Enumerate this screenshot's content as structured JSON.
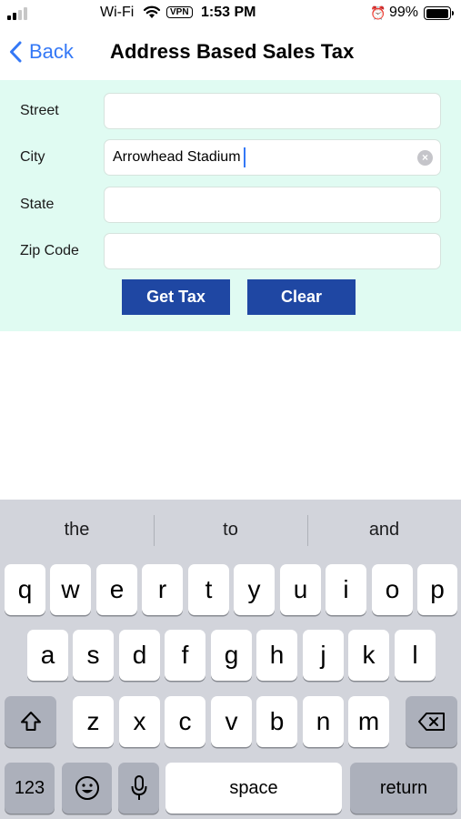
{
  "status_bar": {
    "carrier": "Wi-Fi",
    "vpn": "VPN",
    "time": "1:53 PM",
    "battery": "99%",
    "battery_level": 0.99
  },
  "nav": {
    "back_label": "Back",
    "title": "Address Based Sales Tax"
  },
  "form": {
    "street_label": "Street",
    "street_value": "",
    "city_label": "City",
    "city_value": "Arrowhead Stadium",
    "state_label": "State",
    "state_value": "",
    "zip_label": "Zip Code",
    "zip_value": "",
    "get_tax_label": "Get Tax",
    "clear_label": "Clear"
  },
  "keyboard": {
    "suggestions": [
      "the",
      "to",
      "and"
    ],
    "row1": [
      "q",
      "w",
      "e",
      "r",
      "t",
      "y",
      "u",
      "i",
      "o",
      "p"
    ],
    "row2": [
      "a",
      "s",
      "d",
      "f",
      "g",
      "h",
      "j",
      "k",
      "l"
    ],
    "row3": [
      "z",
      "x",
      "c",
      "v",
      "b",
      "n",
      "m"
    ],
    "numbers_label": "123",
    "space_label": "space",
    "return_label": "return"
  },
  "colors": {
    "accent": "#3478f6",
    "form_background": "#e0fbf2",
    "button_background": "#1f47a3",
    "keyboard_background": "#d2d4db"
  }
}
